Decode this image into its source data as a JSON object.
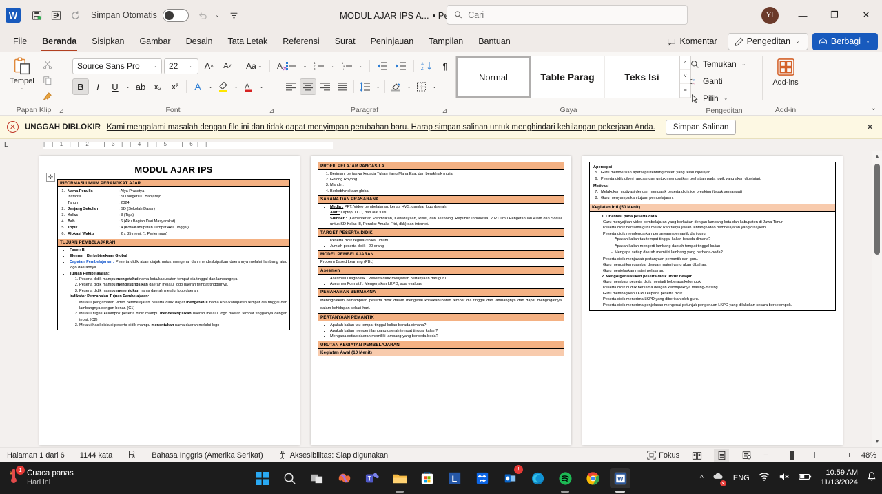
{
  "titlebar": {
    "logo": "W",
    "autosave_label": "Simpan Otomatis",
    "autosave_state": "off",
    "doc_title": "MODUL AJAR IPS A...",
    "doc_status": "• Pengunggahan Diblokir",
    "search_placeholder": "Cari",
    "avatar_initials": "YI",
    "quick_icons": [
      "save-icon",
      "customize-icon",
      "undo-icon",
      "qat-dropdown-icon"
    ],
    "minimize": "—",
    "restore": "❐",
    "close": "✕"
  },
  "tabs": {
    "items": [
      "File",
      "Beranda",
      "Sisipkan",
      "Gambar",
      "Desain",
      "Tata Letak",
      "Referensi",
      "Surat",
      "Peninjauan",
      "Tampilan",
      "Bantuan"
    ],
    "active": "Beranda",
    "comment_label": "Komentar",
    "editing_label": "Pengeditan",
    "share_label": "Berbagi"
  },
  "ribbon": {
    "groups": [
      {
        "name": "Papan Klip",
        "paste_label": "Tempel"
      },
      {
        "name": "Font"
      },
      {
        "name": "Paragraf"
      },
      {
        "name": "Gaya"
      },
      {
        "name": "Pengeditan"
      },
      {
        "name": "Add-in"
      }
    ],
    "font": {
      "family": "Source Sans Pro",
      "size": "22",
      "grow_label": "A",
      "shrink_label": "A",
      "change_case": "Aa",
      "clear_format": "A",
      "bold": "B",
      "italic": "I",
      "underline": "U",
      "strikethrough": "ab",
      "subscript": "x₂",
      "superscript": "x²",
      "text_effects": "A",
      "highlight": "A",
      "font_color": "A"
    },
    "styles": {
      "items": [
        "Normal",
        "Table Parag",
        "Teks Isi"
      ],
      "selected": "Normal"
    },
    "editing": {
      "find_label": "Temukan",
      "replace_label": "Ganti",
      "select_label": "Pilih"
    },
    "addins_label": "Add-ins"
  },
  "warning": {
    "title": "UNGGAH DIBLOKIR",
    "message": "Kami mengalami masalah dengan file ini dan tidak dapat menyimpan perubahan baru. Harap simpan salinan untuk menghindari kehilangan pekerjaan Anda.",
    "button": "Simpan Salinan",
    "close": "✕"
  },
  "ruler": {
    "corner": "L",
    "ticks": "|···|·· 1 ··|···|·· 2 ··|···|·· 3 ··|···|·· 4 ··|···|·· 5 ··|···|·· 6 ·|···|··"
  },
  "document": {
    "page1": {
      "title": "MODUL AJAR IPS",
      "section1_header": "INFORMASI UMUM PERANGKAT AJAR",
      "info_rows": [
        {
          "num": "1.",
          "key": "Nama Penulis",
          "value": ": Alya Prasetya",
          "bold": true
        },
        {
          "num": "",
          "key": "Instansi",
          "value": ": SD Negeri 01 Banjarejo",
          "bold": false
        },
        {
          "num": "",
          "key": "Tahun",
          "value": ": 2024",
          "bold": false
        },
        {
          "num": "2.",
          "key": "Jenjang Sekolah",
          "value": ": SD (Sekolah Dasar)",
          "bold": true
        },
        {
          "num": "3.",
          "key": "Kelas",
          "value": ": 3 (Tiga)",
          "bold": true
        },
        {
          "num": "4.",
          "key": "Bab",
          "value": ": 6 (Aku Bagian Dari Masyarakat)",
          "bold": true
        },
        {
          "num": "5.",
          "key": "Topik",
          "value": ": A (Kota/Kabupaten Tempat Aku Tinggal)",
          "bold": true
        },
        {
          "num": "6.",
          "key": "Alokasi Waktu",
          "value": ": 2 x 35 menit (1 Pertemuan)",
          "bold": true
        }
      ],
      "section2_header": "TUJUAN PEMBELAJARAN",
      "fase": "Fase : B",
      "elemen": "Elemen : Berkebinekaan Global",
      "capaian_label": "Capaian Pembelajaran  :",
      "capaian_text": "Peserta didik akan diajak untuk mengenal dan mendeskripsikan daerahnya melalui lambang atau logo daerahnya.",
      "tujuan_label": "Tujuan Pembelajaran:",
      "tujuan_items": [
        "Peserta didik  mampu <b>mengetahui</b> nama kota/kabupaten tempat dia tinggal dan lambangnya.",
        "Peserta didik mampu <b>mendeskripsikan</b> daerah melalui logo daerah tempat tinggalnya.",
        "Peserta didik mampu <b>menentukan</b> nama daerah melalui logo daerah."
      ],
      "indikator_label": "Indikator Pencapaian Tujuan Pembelajaran:",
      "indikator_items": [
        "Melalui pengamatan video pembelajaran peserta didik dapat <b>mengetahui</b> nama kota/kabupaten tempat dia tinggal dan lambangnya dengan benar. (C1)",
        "Melalui tugas kelompok peserta didik mampu <b>mendeskripsikan</b> daerah melalui logo daerah tempat tinggalnya dengan tepat. (C2)",
        "Melalui hasil diskusi peserta didik mampu <b>menentukan</b> nama daerah melalui logo"
      ]
    },
    "page2": {
      "profil_header": "PROFIL PELAJAR PANCASILA",
      "profil_items": [
        "Beriman, bertakwa kepada Tuhan Yang Maha Esa, dan berakhlak mulia;",
        "Gotong Royong",
        "Mandiri;",
        "Berkebhinekaan global"
      ],
      "sarana_header": "SARANA DAN PRASARANA",
      "sarana_items": [
        "<b><u>Media :</u></b> PPT, Video pembelajaran, kertas HVS, gambar logo daerah.",
        "<b><u>Alat :</u></b> Laptop, LCD, dan alat tulis",
        "<b>Sumber  :</b>  (Kementerian  Pendidikan,  Kebudayaan,  Riset,  dan  Teknologi Republik Indonesia, 2021 Ilmu Pengetahuan Alam dan Sosial untuk SD Kelas III, Penulis: Amalia Fitri, dkk) dan internet."
      ],
      "target_header": "TARGET PESERTA DIDIK",
      "target_items": [
        "Peserta didik regular/tipikal umum",
        "Jumlah peserta didik : 20 orang"
      ],
      "model_header": "MODEL PEMBELAJARAN",
      "model_text": "Problem Based Learning (PBL)",
      "asesmen_header": "Asesmen",
      "asesmen_items": [
        "Asesmen Diagnostik : Peserta didik menjawab pertanyaan dari guru",
        "Asesmen Formatif : Mengerjakan LKPD, soal evaluasi"
      ],
      "pemahaman_header": "PEMAHAMAN BERMAKNA",
      "pemahaman_text": "Meningkatkan kemampuan peserta didik dalam mengenal kota/kabupaten tempat dia tinggal dan lambangnya dan dapat mengingatnya dalam kehidupan sehari-hari.",
      "pertanyaan_header": "PERTANYAAN PEMANTIK",
      "pertanyaan_items": [
        "Apakah kalian tau tempat tinggal kalian berada dimana?",
        "Apakah kalian mengerti lambang daerah tempat tinggal kalian?",
        "Mengapa setiap daerah memiliki lambang yang berbeda-beda?"
      ],
      "urutan_header": "URUTAN KEGIATAN PEMBELAJARAN",
      "kegiatan_awal_header": "Kegiatan Awal (10 Menit)"
    },
    "page3": {
      "apersepsi_label": "Apersepsi",
      "apersepsi_items": [
        {
          "num": "5.",
          "text": "Guru memberikan apersepsi tentang materi yang telah dipelajari."
        },
        {
          "num": "6.",
          "text": "Peserta didik diberi rangsangan untuk memusatkan perhatian pada topik yang akan dipelajari."
        }
      ],
      "motivasi_label": "Motivasi",
      "motivasi_items": [
        {
          "num": "7.",
          "text": "Melakukan motivasi dengan mengajak peserta didik ice breaking (tepuk semangat)"
        },
        {
          "num": "8.",
          "text": "Guru menyampaikan tujuan pembelajaran."
        }
      ],
      "inti_header": "Kegiatan Inti (50 Menit)",
      "step1_label": "1.  Orientasi pada peserta didik.",
      "step1_items": [
        "Guru menyajikan video pembelajaran yang berkaitan dengan lambang kota dan kabupaten di Jawa Timur.",
        "Peserta didik bersama guru melakukan tanya jawab tentang video pembelajaran yang disajikan.",
        "Peserta didik mendengarkan pertanyaan pemantik dari guru"
      ],
      "sub_items": [
        "Apakah kalian tau tempat tinggal kalian berada dimana?",
        "Apakah kalian mengerti lambang daerah tempat tinggal kalian",
        "Mengapa setiap daerah memiliki lambang yang berbeda-beda?"
      ],
      "after_sub_items": [
        "Peserta didik menjawab pertanyaan pemantik dari guru.",
        "Guru mengaitkan gambar dengan materi yang akan dibahas.",
        "Guru menjelaskan materi pelajaran."
      ],
      "step2_label": "2.  Mengorganisasikan peserta didik untuk belajar.",
      "step2_items": [
        "Guru membagi peserta didik menjadi beberapa kelompok",
        "Peserta didik duduk bersama dengan kelompoknya masing-masing.",
        "Guru membagikan LKPD kepada peserta didik.",
        "Peserta didik menerima LKPD yang diberikan oleh guru.",
        "Peserta didik menerima penjelasan mengenai petunjuk pengerjaan LKPD yang dilakukan secara berkelompok."
      ]
    }
  },
  "statusbar": {
    "page_info": "Halaman 1 dari 6",
    "word_count": "1144 kata",
    "proofing_icon": "spellcheck-icon",
    "language": "Bahasa Inggris (Amerika Serikat)",
    "accessibility": "Aksesibilitas: Siap digunakan",
    "focus_label": "Fokus",
    "views": [
      "read-mode-icon",
      "print-layout-icon",
      "web-layout-icon"
    ],
    "selected_view": "print-layout-icon",
    "zoom_out": "−",
    "zoom_in": "+",
    "zoom_level": "48%"
  },
  "taskbar": {
    "weather_title": "Cuaca panas",
    "weather_sub": "Hari ini",
    "weather_badge": "1",
    "apps": [
      {
        "name": "start-button",
        "icon": "windows-logo"
      },
      {
        "name": "search-button",
        "icon": "search"
      },
      {
        "name": "task-view-button",
        "icon": "task-view"
      },
      {
        "name": "copilot-app",
        "icon": "copilot"
      },
      {
        "name": "teams-app",
        "icon": "teams"
      },
      {
        "name": "file-explorer-app",
        "icon": "folder"
      },
      {
        "name": "microsoft-store-app",
        "icon": "store"
      },
      {
        "name": "linkedin-app",
        "icon": "linkedin"
      },
      {
        "name": "dropbox-app",
        "icon": "dropbox"
      },
      {
        "name": "outlook-app",
        "icon": "outlook",
        "badge": "!"
      },
      {
        "name": "edge-app",
        "icon": "edge"
      },
      {
        "name": "spotify-app",
        "icon": "spotify"
      },
      {
        "name": "chrome-app",
        "icon": "chrome"
      },
      {
        "name": "word-app",
        "icon": "word"
      }
    ],
    "tray": {
      "overflow": "^",
      "language": "ENG",
      "time": "10:59 AM",
      "date": "11/13/2024"
    }
  }
}
